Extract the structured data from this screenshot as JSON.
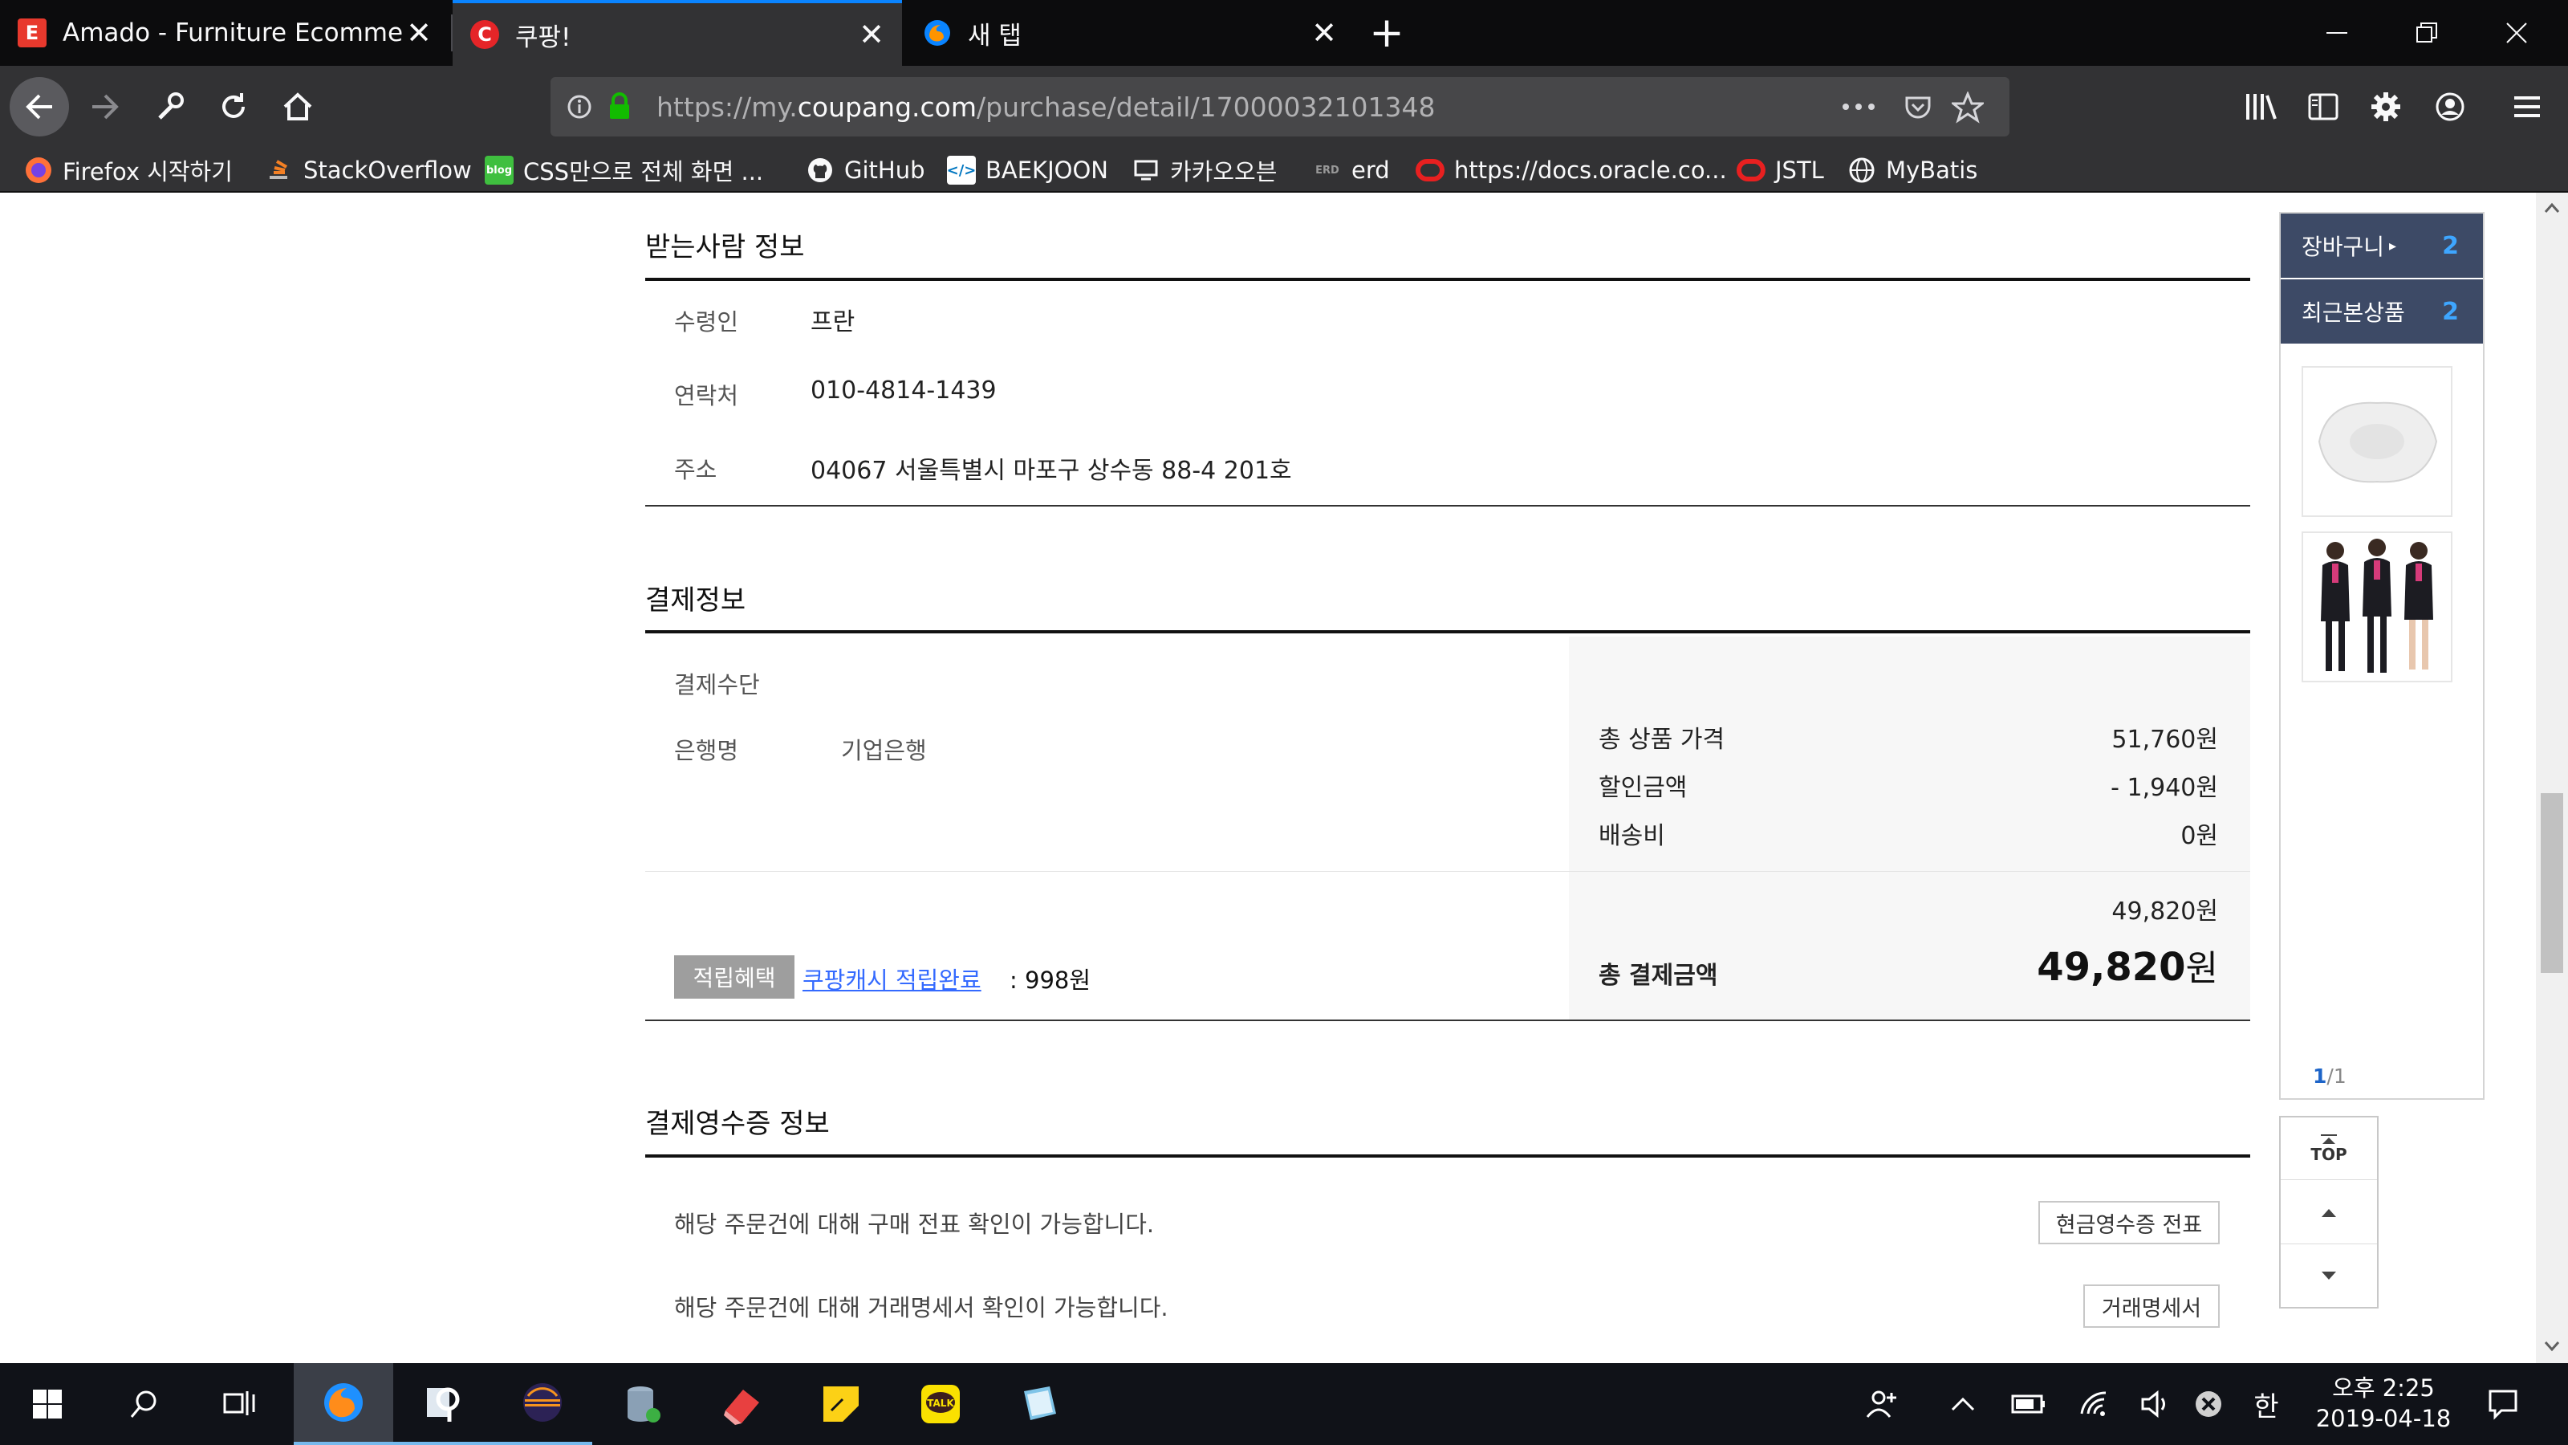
{
  "browser": {
    "tabs": [
      {
        "title": "Amado - Furniture Ecommerce",
        "favicon": "E",
        "favicon_color": "#e8392d",
        "active": false
      },
      {
        "title": "쿠팡!",
        "favicon": "C",
        "favicon_color": "#e52528",
        "active": true
      },
      {
        "title": "새 탭",
        "favicon": "firefox-icon",
        "active": false
      }
    ],
    "url": {
      "prefix": "https://my.",
      "domain": "coupang.com",
      "path": "/purchase/detail/17000032101348"
    },
    "bookmarks": [
      {
        "label": "Firefox 시작하기",
        "icon": "firefox-icon"
      },
      {
        "label": "StackOverflow",
        "icon": "stackoverflow-icon"
      },
      {
        "label": "CSS만으로 전체 화면 ...",
        "icon": "blog-icon"
      },
      {
        "label": "GitHub",
        "icon": "github-icon"
      },
      {
        "label": "BAEKJOON",
        "icon": "baekjoon-icon"
      },
      {
        "label": "카카오오븐",
        "icon": "monitor-icon"
      },
      {
        "label": "erd",
        "icon": "erd-icon"
      },
      {
        "label": "https://docs.oracle.co...",
        "icon": "oracle-icon"
      },
      {
        "label": "JSTL",
        "icon": "oracle-icon"
      },
      {
        "label": "MyBatis",
        "icon": "globe-icon"
      }
    ]
  },
  "recipient": {
    "title": "받는사람 정보",
    "rows": [
      {
        "label": "수령인",
        "value": "프란"
      },
      {
        "label": "연락처",
        "value": "010-4814-1439"
      },
      {
        "label": "주소",
        "value": "04067 서울특별시 마포구 상수동 88-4 201호"
      }
    ]
  },
  "payment": {
    "title": "결제정보",
    "method_label": "결제수단",
    "bank_label": "은행명",
    "bank_value": "기업은행",
    "summary": [
      {
        "label": "총 상품 가격",
        "value": "51,760원"
      },
      {
        "label": "할인금액",
        "value": "- 1,940원"
      },
      {
        "label": "배송비",
        "value": "0원"
      }
    ],
    "subtotal": "49,820원",
    "total_label": "총 결제금액",
    "total_number": "49,820",
    "total_unit": "원",
    "reward_tag": "적립혜택",
    "reward_link": "쿠팡캐시 적립완료",
    "reward_amount": ": 998원"
  },
  "receipt": {
    "title": "결제영수증 정보",
    "rows": [
      {
        "text": "해당 주문건에 대해 구매 전표 확인이 가능합니다.",
        "button": "현금영수증 전표"
      },
      {
        "text": "해당 주문건에 대해 거래명세서 확인이 가능합니다.",
        "button": "거래명세서"
      }
    ]
  },
  "side": {
    "cart_label": "장바구니",
    "cart_count": "2",
    "recent_label": "최근본상품",
    "recent_count": "2",
    "page_current": "1",
    "page_total": "/1",
    "top_label": "TOP"
  },
  "taskbar": {
    "time": "오후 2:25",
    "date": "2019-04-18",
    "ime": "한"
  },
  "colors": {
    "link": "#346aff",
    "side_header": "#3d4a66",
    "count": "#3ea6ff",
    "tab_accent": "#0a84ff"
  }
}
